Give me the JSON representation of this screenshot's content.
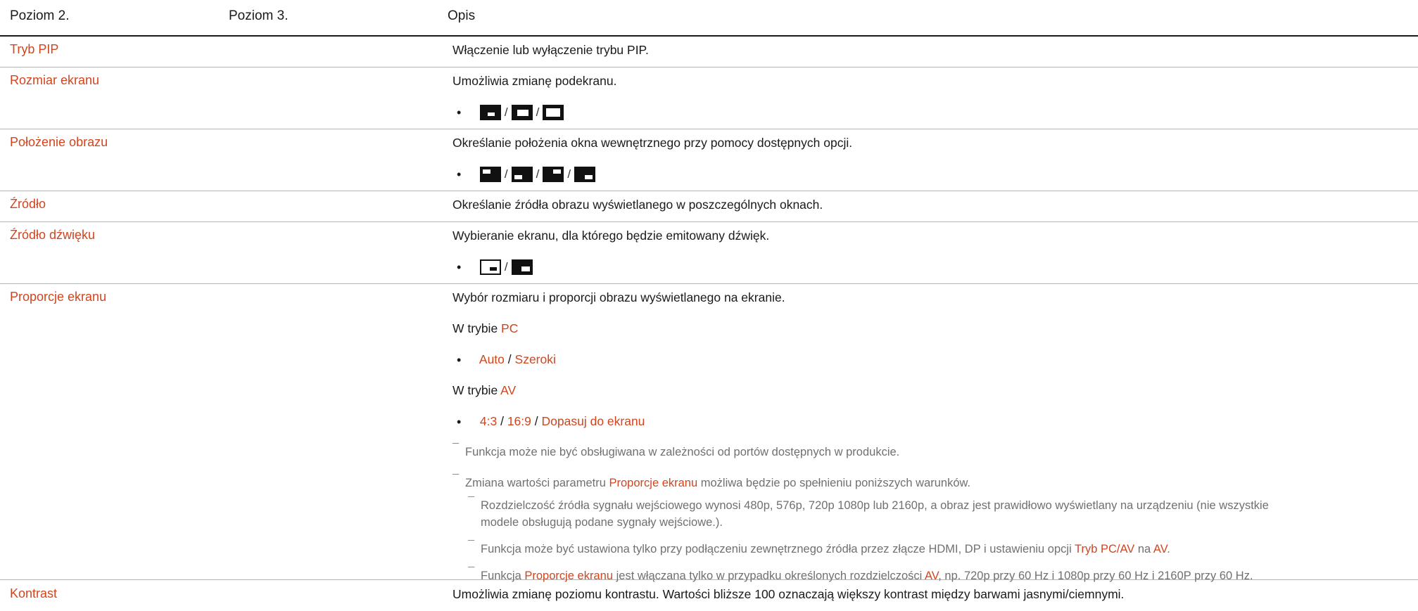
{
  "header": {
    "col1": "Poziom 2.",
    "col2": "Poziom 3.",
    "col3": "Opis"
  },
  "rows": [
    {
      "name": "Tryb PIP",
      "desc": "Włączenie lub wyłączenie trybu PIP."
    },
    {
      "name": "Rozmiar ekranu",
      "desc": "Umożliwia zmianę podekranu."
    },
    {
      "name": "Położenie obrazu",
      "desc": "Określanie położenia okna wewnętrznego przy pomocy dostępnych opcji."
    },
    {
      "name": "Źródło",
      "desc": "Określanie źródła obrazu wyświetlanego w poszczególnych oknach."
    },
    {
      "name": "Źródło dźwięku",
      "desc": "Wybieranie ekranu, dla którego będzie emitowany dźwięk."
    },
    {
      "name": "Proporcje ekranu",
      "desc": "Wybór rozmiaru i proporcji obrazu wyświetlanego na ekranie."
    },
    {
      "name": "Kontrast",
      "desc": "Umożliwia zmianę poziomu kontrastu. Wartości bliższe 100 oznaczają większy kontrast między barwami jasnymi/ciemnymi."
    }
  ],
  "proporcje": {
    "pc_prefix": "W trybie ",
    "pc_mode": "PC",
    "pc_options": [
      "Auto",
      "Szeroki"
    ],
    "av_prefix": "W trybie ",
    "av_mode": "AV",
    "av_options": [
      "4:3",
      "16:9",
      "Dopasuj do ekranu"
    ],
    "note1": "Funkcja może nie być obsługiwana w zależności od portów dostępnych w produkcie.",
    "note2_a": "Zmiana wartości parametru ",
    "note2_hl": "Proporcje ekranu",
    "note2_b": " możliwa będzie po spełnieniu poniższych warunków.",
    "sub1_line1": "Rozdzielczość źródła sygnału wejściowego wynosi 480p, 576p, 720p 1080p lub 2160p, a obraz jest prawidłowo wyświetlany na urządzeniu (nie wszystkie",
    "sub1_line2": "modele obsługują podane sygnały wejściowe.).",
    "sub2_a": "Funkcja może być ustawiona tylko przy podłączeniu zewnętrznego źródła przez złącze HDMI, DP i ustawieniu opcji ",
    "sub2_hl1": "Tryb PC/AV",
    "sub2_b": " na ",
    "sub2_hl2": "AV",
    "sub2_c": ".",
    "sub3_a": "Funkcja ",
    "sub3_hl1": "Proporcje ekranu",
    "sub3_b": " jest włączana tylko w przypadku określonych rozdzielczości ",
    "sub3_hl2": "AV",
    "sub3_c": ", np. 720p przy 60 Hz i 1080p przy 60 Hz i 2160P przy 60 Hz."
  },
  "symbols": {
    "bullet": "•",
    "separator": "/",
    "dash": "¯"
  },
  "colors": {
    "accent": "#d1451f",
    "note": "#707070"
  }
}
